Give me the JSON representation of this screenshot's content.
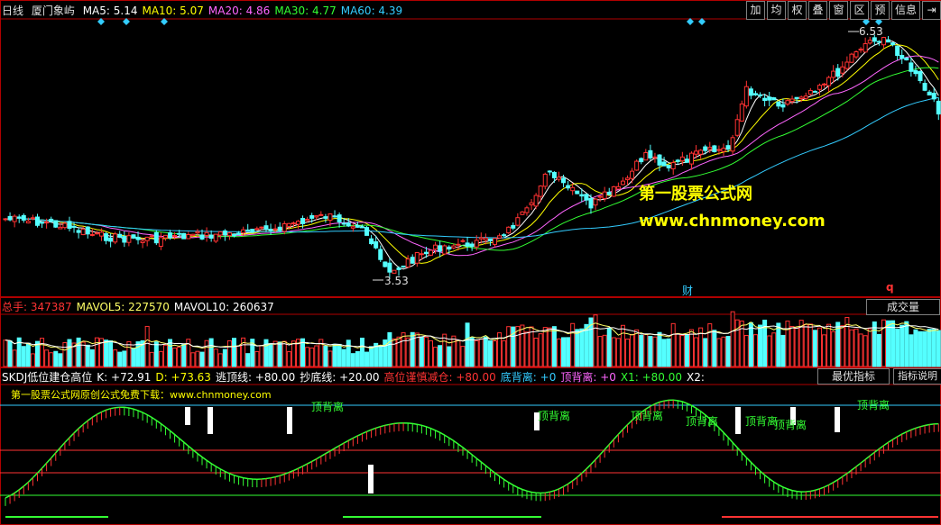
{
  "main": {
    "period": "日线",
    "stock_name": "厦门象屿",
    "ma": [
      {
        "label": "MA5:",
        "value": "5.14",
        "color": "#ffffff"
      },
      {
        "label": "MA10:",
        "value": "5.07",
        "color": "#ffff00"
      },
      {
        "label": "MA20:",
        "value": "4.86",
        "color": "#ff66ff"
      },
      {
        "label": "MA30:",
        "value": "4.77",
        "color": "#33ff33"
      },
      {
        "label": "MA60:",
        "value": "4.39",
        "color": "#33ccff"
      }
    ],
    "high_label": "6.53",
    "low_label": "3.53",
    "watermark_title": "第一股票公式网",
    "watermark_url": "www.chnmoney.com",
    "finance_marker": "财",
    "q_marker": "q"
  },
  "toolbar": [
    "加",
    "均",
    "权",
    "叠",
    "窗",
    "区",
    "预",
    "信息",
    "⇥"
  ],
  "volume": {
    "legend": [
      {
        "label": "总手:",
        "value": "347387",
        "color": "#ff3333"
      },
      {
        "label": "MAVOL5:",
        "value": "227570",
        "color": "#ffff66"
      },
      {
        "label": "MAVOL10:",
        "value": "260637",
        "color": "#ffffff"
      }
    ],
    "button": "成交量"
  },
  "indicator": {
    "legend": [
      {
        "text": "SKDJ低位建仓高位",
        "color": "#ffffff"
      },
      {
        "text": "K: +72.91",
        "color": "#ffffff"
      },
      {
        "text": "D: +73.63",
        "color": "#ffff00"
      },
      {
        "text": "逃顶线: +80.00",
        "color": "#ffffff"
      },
      {
        "text": "抄底线: +20.00",
        "color": "#ffffff"
      },
      {
        "text": "高位谨慎减仓: +80.00",
        "color": "#ff3333"
      },
      {
        "text": "底背离: +0",
        "color": "#33ccff"
      },
      {
        "text": "顶背离: +0",
        "color": "#ff66ff"
      },
      {
        "text": "X1: +80.00",
        "color": "#33ff33"
      },
      {
        "text": "X2:",
        "color": "#ffffff"
      }
    ],
    "btn_best": "最优指标",
    "btn_help": "指标说明",
    "subtitle": "第一股票公式网原创公式免费下载：www.chnmoney.com",
    "divergence_label": "顶背离",
    "bottom_label": "底背离"
  },
  "colors": {
    "up": "#ff3232",
    "down": "#54ffff",
    "grid_red": "#b00000",
    "border": "#b00000"
  }
}
